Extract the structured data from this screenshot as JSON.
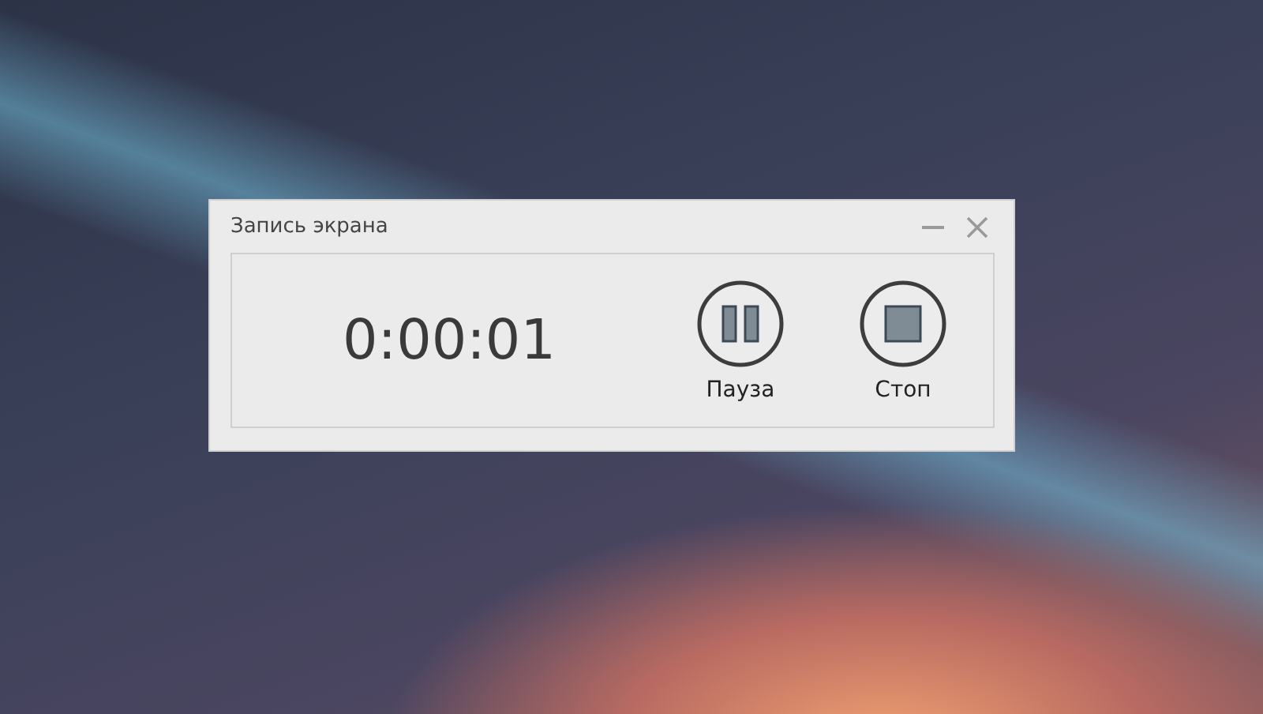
{
  "window": {
    "title": "Запись экрана"
  },
  "timer": "0:00:01",
  "buttons": [
    {
      "kind": "pause",
      "label": "Пауза"
    },
    {
      "kind": "stop",
      "label": "Стоп"
    }
  ]
}
